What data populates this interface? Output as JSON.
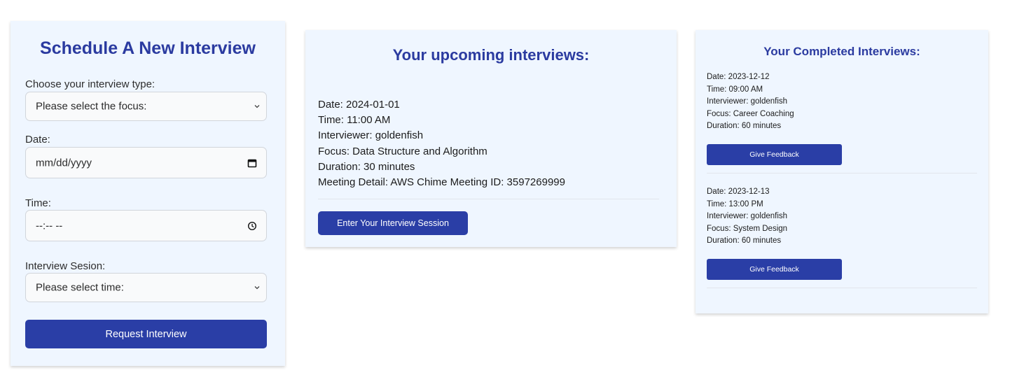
{
  "schedule": {
    "title": "Schedule A New Interview",
    "type_label": "Choose your interview type:",
    "type_select_value": "Please select the focus:",
    "date_label": "Date:",
    "date_placeholder": "mm/dd/yyyy",
    "time_label": "Time:",
    "time_placeholder": "--:-- --",
    "session_label": "Interview Sesion:",
    "session_select_value": "Please select time:",
    "submit_label": "Request Interview"
  },
  "upcoming": {
    "title": "Your upcoming interviews:",
    "interview": {
      "date": "Date: 2024-01-01",
      "time": "Time: 11:00 AM",
      "interviewer": "Interviewer: goldenfish",
      "focus": "Focus: Data Structure and Algorithm",
      "duration": "Duration: 30 minutes",
      "meeting": "Meeting Detail: AWS Chime Meeting ID: 3597269999"
    },
    "enter_label": "Enter Your Interview Session"
  },
  "completed": {
    "title": "Your Completed Interviews:",
    "items": [
      {
        "date": "Date: 2023-12-12",
        "time": "Time: 09:00 AM",
        "interviewer": "Interviewer: goldenfish",
        "focus": "Focus: Career Coaching",
        "duration": "Duration: 60 minutes",
        "feedback_label": "Give Feedback"
      },
      {
        "date": "Date: 2023-12-13",
        "time": "Time: 13:00 PM",
        "interviewer": "Interviewer: goldenfish",
        "focus": "Focus: System Design",
        "duration": "Duration: 60 minutes",
        "feedback_label": "Give Feedback"
      }
    ]
  },
  "icons": {
    "select_arrow": "chevron-down-icon",
    "date_picker": "calendar-icon",
    "time_picker": "clock-icon"
  },
  "colors": {
    "accent": "#2a3ea6",
    "heading": "#2b3ba0",
    "card_bg": "#eff6ff"
  }
}
